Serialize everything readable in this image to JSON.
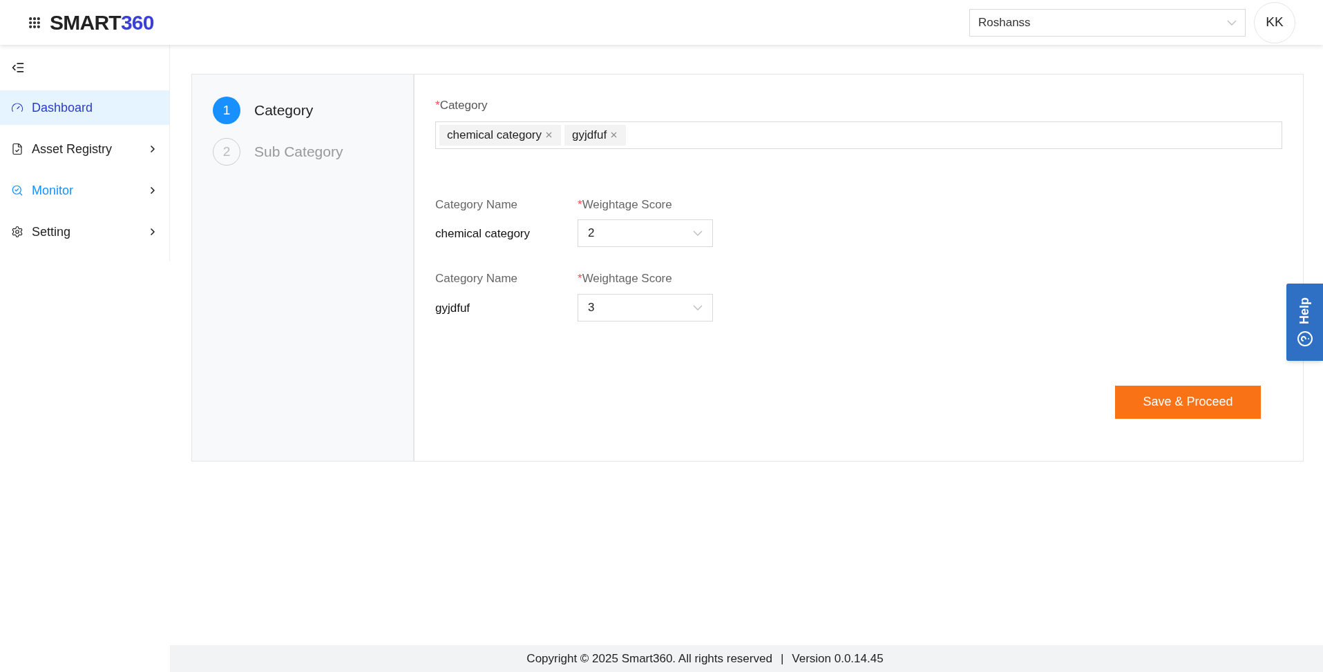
{
  "header": {
    "logo": {
      "main": "SMART",
      "accent": "360"
    },
    "site_select": {
      "value": "Roshanss"
    },
    "avatar": "KK"
  },
  "sidebar": {
    "items": [
      {
        "label": "Dashboard",
        "selected": true,
        "highlighted": false,
        "has_submenu": false
      },
      {
        "label": "Asset Registry",
        "selected": false,
        "highlighted": false,
        "has_submenu": true
      },
      {
        "label": "Monitor",
        "selected": false,
        "highlighted": true,
        "has_submenu": true
      },
      {
        "label": "Setting",
        "selected": false,
        "highlighted": false,
        "has_submenu": true
      }
    ]
  },
  "steps": [
    {
      "number": "1",
      "label": "Category",
      "selected": true
    },
    {
      "number": "2",
      "label": "Sub Category",
      "selected": false
    }
  ],
  "form": {
    "category_label": "Category",
    "category_required_mark": "*",
    "tags": [
      "chemical category",
      "gyjdfuf"
    ],
    "rows": [
      {
        "name_label": "Category Name",
        "name": "chemical category",
        "score_label": "Weightage Score",
        "score_required_mark": "*",
        "score": "2"
      },
      {
        "name_label": "Category Name",
        "name": "gyjdfuf",
        "score_label": "Weightage Score",
        "score_required_mark": "*",
        "score": "3"
      }
    ],
    "submit": "Save & Proceed"
  },
  "help_tab": "Help",
  "footer": {
    "copyright": "Copyright © 2025 Smart360. All rights reserved",
    "separator": "|",
    "version": "Version 0.0.14.45"
  }
}
